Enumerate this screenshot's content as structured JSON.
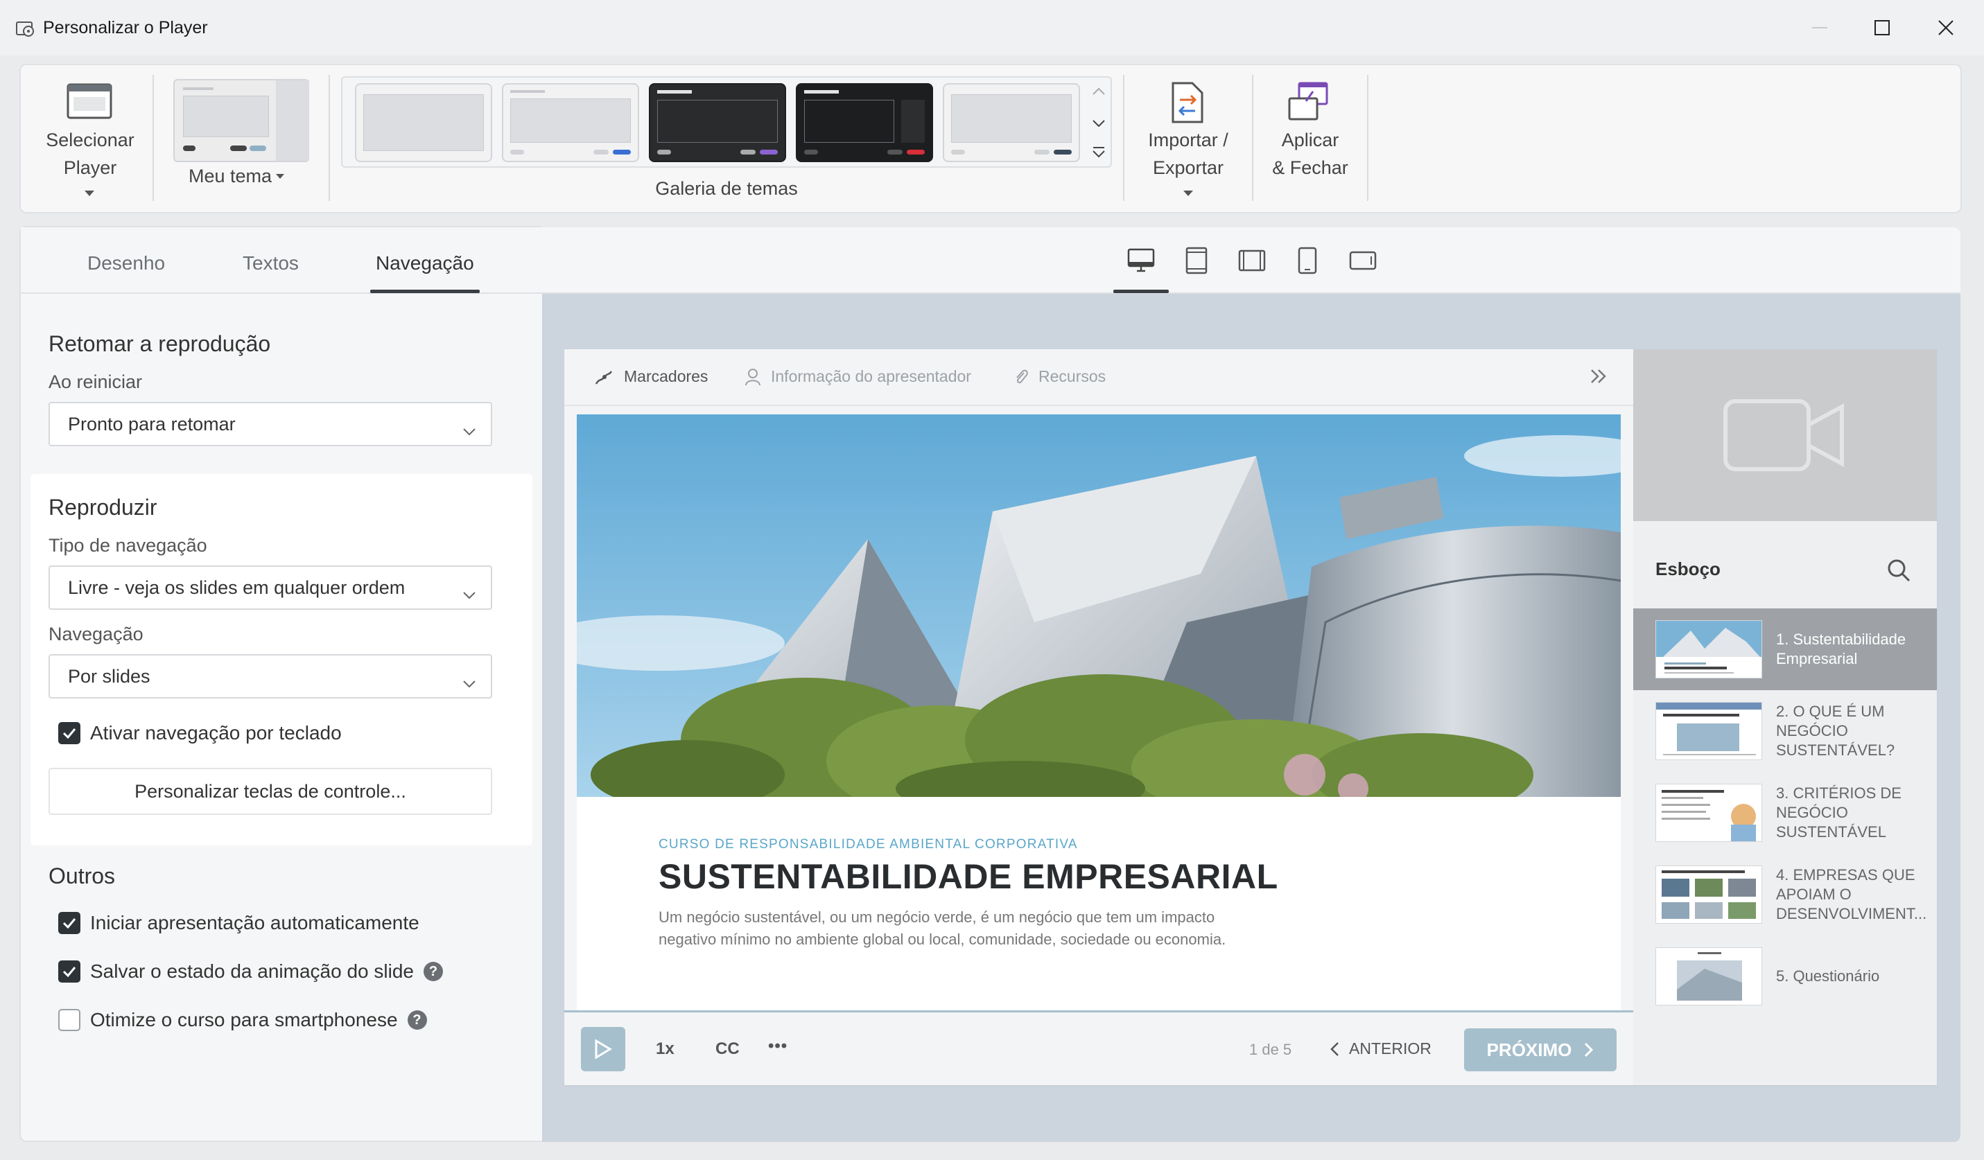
{
  "window": {
    "title": "Personalizar o Player"
  },
  "ribbon": {
    "select_player": [
      "Selecionar",
      "Player"
    ],
    "my_theme": "Meu tema",
    "theme_gallery": "Galeria de temas",
    "import_export": [
      "Importar /",
      "Exportar"
    ],
    "apply_close": [
      "Aplicar",
      "& Fechar"
    ]
  },
  "left_tabs": [
    "Desenho",
    "Textos",
    "Navegação"
  ],
  "active_left_tab": "Navegação",
  "resume": {
    "title": "Retomar a reprodução",
    "restart_label": "Ao reiniciar",
    "restart_value": "Pronto para retomar"
  },
  "play": {
    "title": "Reproduzir",
    "nav_type_label": "Tipo de navegação",
    "nav_type_value": "Livre - veja os slides em qualquer ordem",
    "nav_label": "Navegação",
    "nav_value": "Por slides",
    "keyboard_nav": {
      "label": "Ativar navegação por teclado",
      "checked": true
    },
    "customize_keys": "Personalizar teclas de controle..."
  },
  "others": {
    "title": "Outros",
    "items": [
      {
        "label": "Iniciar apresentação automaticamente",
        "checked": true,
        "help": false
      },
      {
        "label": "Salvar o estado da animação do slide",
        "checked": true,
        "help": true
      },
      {
        "label": "Otimize o curso para smartphonese",
        "checked": false,
        "help": true
      }
    ]
  },
  "player": {
    "tabs": [
      "Marcadores",
      "Informação do apresentador",
      "Recursos"
    ],
    "slide": {
      "kicker": "CURSO DE RESPONSABILIDADE AMBIENTAL CORPORATIVA",
      "title": "SUSTENTABILIDADE EMPRESARIAL",
      "description": "Um negócio sustentável, ou um negócio verde, é um negócio que tem um impacto negativo mínimo no ambiente global ou local, comunidade, sociedade ou economia."
    },
    "controls": {
      "speed": "1x",
      "cc": "CC",
      "more": "•••",
      "page": "1 de 5",
      "prev": "ANTERIOR",
      "next": "PRÓXIMO"
    },
    "outline": {
      "title": "Esboço",
      "items": [
        "1. Sustentabilidade Empresarial",
        "2. O QUE É UM NEGÓCIO SUSTENTÁVEL?",
        "3. CRITÉRIOS DE NEGÓCIO SUSTENTÁVEL",
        "4. EMPRESAS QUE APOIAM O DESENVOLVIMENT...",
        "5. Questionário"
      ],
      "active_index": 0
    }
  },
  "colors": {
    "accent_player": "#a6bfcd",
    "preview_bg": "#ccd4dd",
    "kicker": "#5aa6c8"
  }
}
